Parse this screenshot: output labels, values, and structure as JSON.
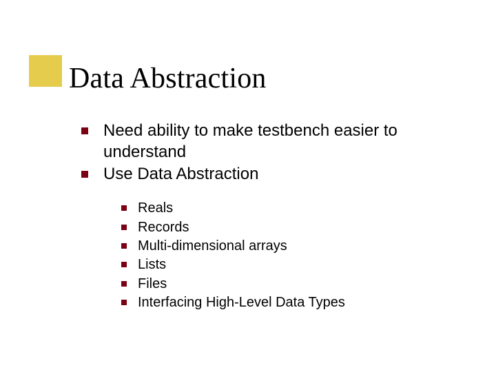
{
  "title": "Data Abstraction",
  "bullets": [
    {
      "text": "Need ability to make testbench easier to understand"
    },
    {
      "text": "Use Data Abstraction"
    }
  ],
  "sub_bullets": [
    {
      "text": "Reals"
    },
    {
      "text": "Records"
    },
    {
      "text": "Multi-dimensional arrays"
    },
    {
      "text": "Lists"
    },
    {
      "text": "Files"
    },
    {
      "text": "Interfacing High-Level Data Types"
    }
  ]
}
